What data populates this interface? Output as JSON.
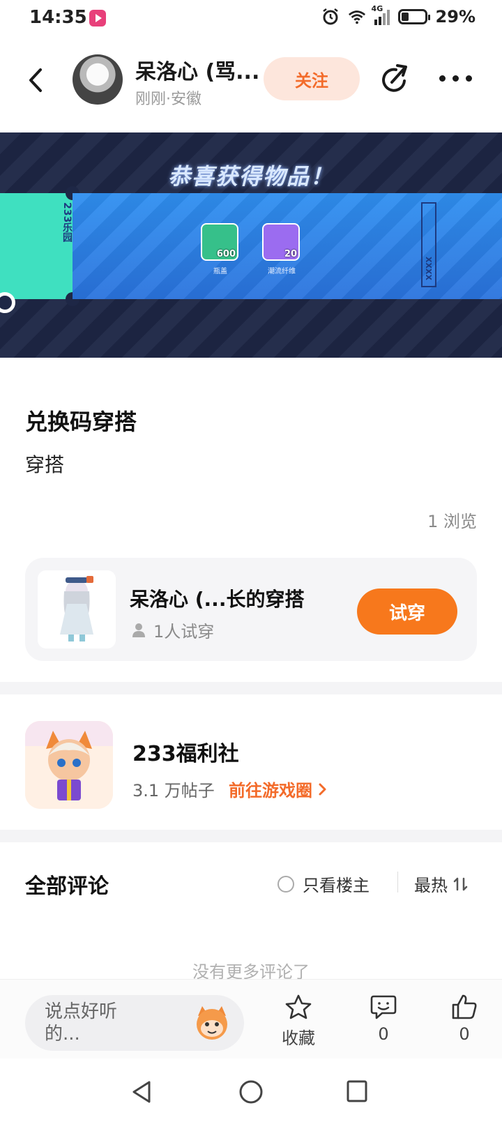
{
  "status_bar": {
    "time": "14:35",
    "network": "4G",
    "battery": "29%"
  },
  "header": {
    "author_name": "呆洛心 (骂...",
    "author_meta": "刚刚·安徽",
    "follow_label": "关注"
  },
  "banner": {
    "title": "恭喜获得物品！",
    "ticket_code": "233乐园",
    "items": [
      {
        "name": "瓶盖",
        "count": "600",
        "color": "#36c08a"
      },
      {
        "name": "潮流纤维",
        "count": "20",
        "color": "#9b6cf0"
      }
    ],
    "barcode_text": "XXXX"
  },
  "post": {
    "title": "兑换码穿搭",
    "body": "穿搭",
    "views": "1 浏览"
  },
  "outfit": {
    "name": "呆洛心 (...长的穿搭",
    "tries": "1人试穿",
    "try_label": "试穿"
  },
  "community": {
    "name": "233福利社",
    "posts": "3.1 万帖子",
    "link_label": "前往游戏圈"
  },
  "comments": {
    "title": "全部评论",
    "only_op_label": "只看楼主",
    "sort_label": "最热",
    "empty_text": "没有更多评论了"
  },
  "bottom_bar": {
    "input_placeholder": "说点好听的...",
    "favorite_label": "收藏",
    "comment_count": "0",
    "like_count": "0"
  },
  "colors": {
    "accent": "#f36b2a",
    "try_button": "#f7781c",
    "follow_bg": "#fde6dc"
  }
}
